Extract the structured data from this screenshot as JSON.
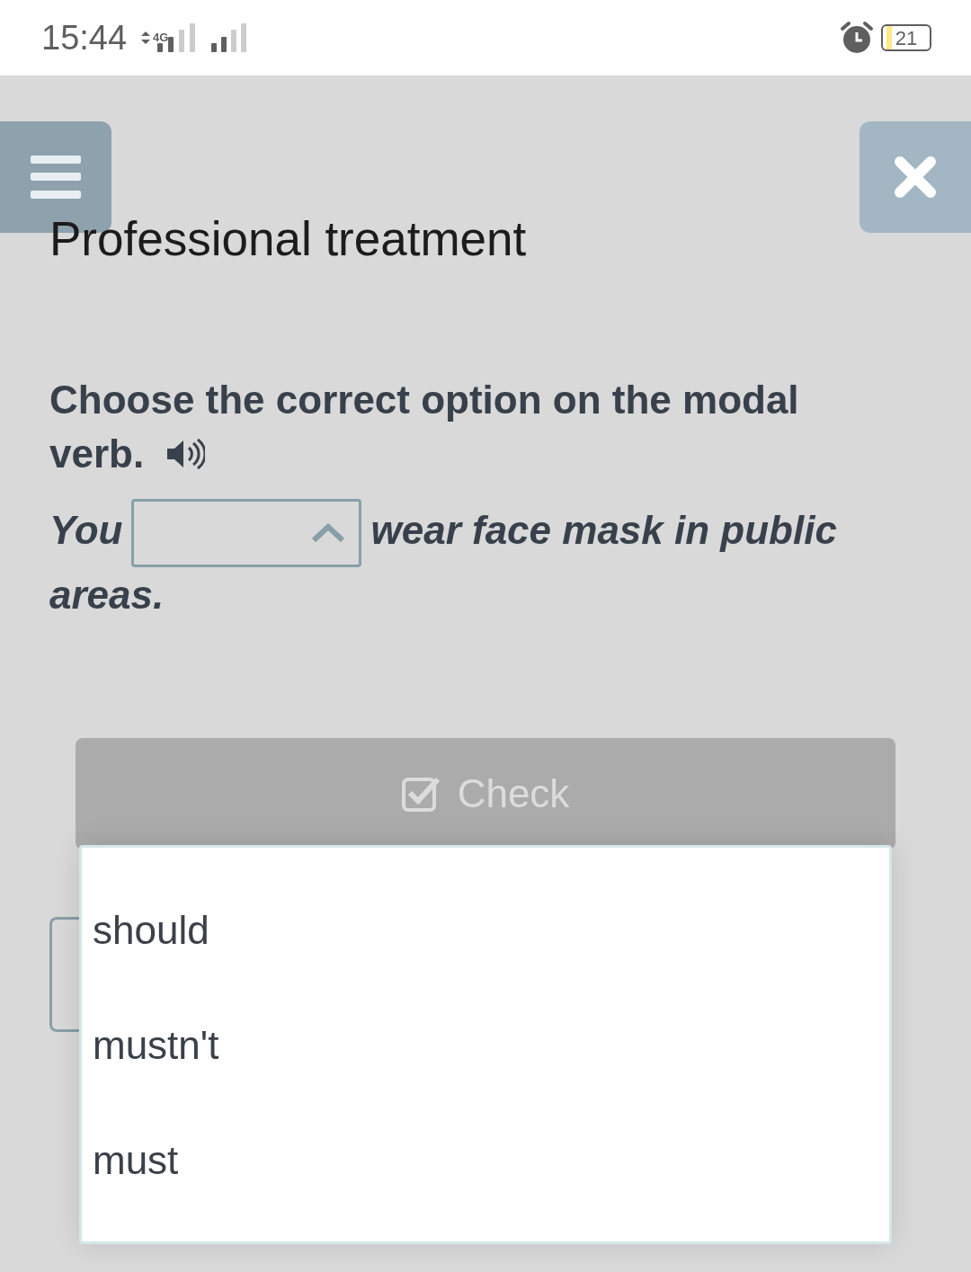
{
  "status_bar": {
    "time": "15:44",
    "network": "4G",
    "battery": "21"
  },
  "title": "Professional treatment",
  "instruction_lines": [
    "Choose the correct option on the modal",
    "verb."
  ],
  "sentence": {
    "before": "You",
    "after_lines": [
      "wear face mask in public",
      "areas."
    ]
  },
  "dropdown": {
    "expanded": true,
    "options": [
      {
        "label": "should",
        "selected": false
      },
      {
        "label": "mustn't",
        "selected": false
      },
      {
        "label": "must",
        "selected": false
      }
    ]
  },
  "check_button": {
    "label": "Check",
    "disabled": true
  }
}
